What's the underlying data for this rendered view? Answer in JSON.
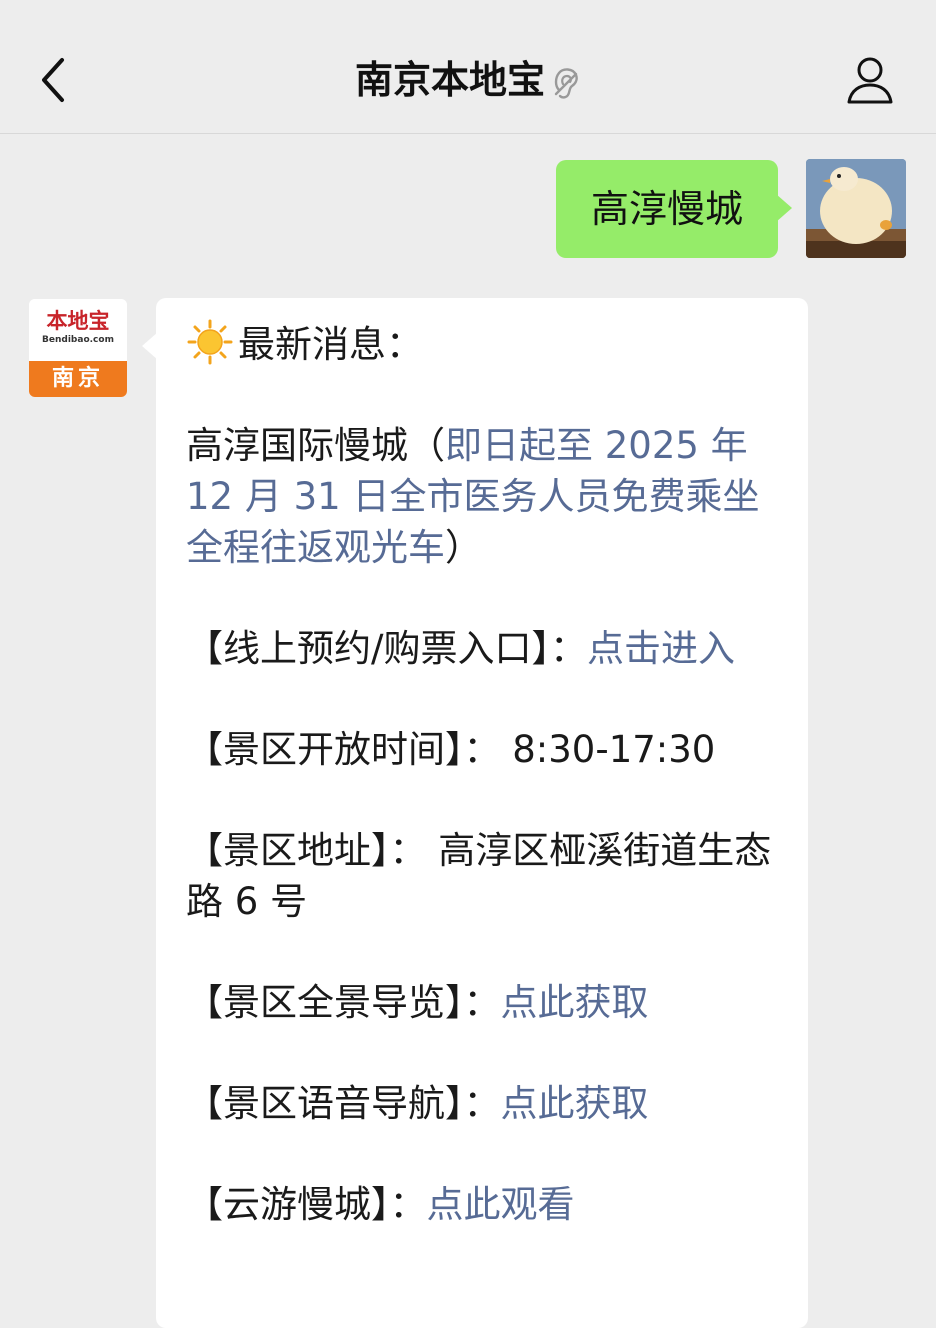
{
  "navbar": {
    "title": "南京本地宝",
    "back_icon": "chevron-left-icon",
    "profile_icon": "person-icon",
    "ear_icon": "ear-icon"
  },
  "conversation": {
    "outgoing": {
      "text": "高淳慢城",
      "bubble_color": "#95ec69"
    },
    "incoming": {
      "avatar": {
        "logo_text": "本地宝",
        "logo_sub": "Bendibao.com",
        "city": "南京",
        "accent_color": "#ef7a1e"
      },
      "headline": {
        "icon": "sun-icon",
        "text": "最新消息："
      },
      "intro": {
        "prefix": "高淳国际慢城（",
        "link": "即日起至 2025 年 12 月 31 日全市医务人员免费乘坐全程往返观光车",
        "suffix": "）"
      },
      "booking": {
        "label": "【线上预约/购票入口】：",
        "link": "点击进入"
      },
      "hours": {
        "label": "【景区开放时间】：",
        "value": " 8:30-17:30"
      },
      "address": {
        "label": "【景区地址】：",
        "value": " 高淳区桠溪街道生态路 6 号"
      },
      "panorama": {
        "label": "【景区全景导览】：",
        "link": "点此获取"
      },
      "audio_guide": {
        "label": "【景区语音导航】：",
        "link": "点此获取"
      },
      "cloud_tour": {
        "label": "【云游慢城】：",
        "link": "点此观看"
      },
      "link_color": "#576b95"
    }
  }
}
